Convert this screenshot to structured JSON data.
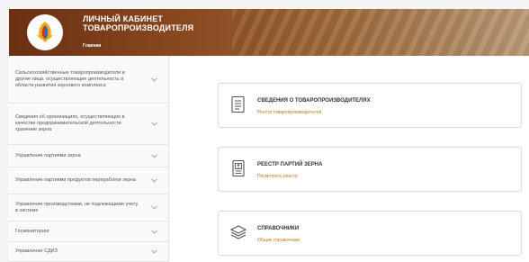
{
  "header": {
    "title_line1": "ЛИЧНЫЙ КАБИНЕТ",
    "title_line2": "ТОВАРОПРОИЗВОДИТЕЛЯ",
    "nav_home": "Главная"
  },
  "sidebar": {
    "items": [
      {
        "label": "Сельскохозяйственные товаропроизводители и другие лица, осуществляющие деятельность в области развития зернового комплекса"
      },
      {
        "label": "Сведения об организациях, осуществляющих в качестве предпринимательской деятельности хранение зерна"
      },
      {
        "label": "Управление партиями зерна"
      },
      {
        "label": "Управление партиями продуктов переработки зерна"
      },
      {
        "label": "Управление производствами, не подлежащими учету в системе"
      },
      {
        "label": "Госмониторинг"
      },
      {
        "label": "Управление СДИЗ"
      }
    ]
  },
  "cards": [
    {
      "title": "СВЕДЕНИЯ О ТОВАРОПРОИЗВОДИТЕЛЯХ",
      "link": "Реестр товаропроизводителей",
      "icon": "document-list-icon"
    },
    {
      "title": "РЕЕСТР ПАРТИЙ ЗЕРНА",
      "link": "Посмотреть реестр",
      "icon": "grain-register-icon"
    },
    {
      "title": "СПРАВОЧНИКИ",
      "link": "Общие справочники",
      "icon": "layers-icon"
    }
  ],
  "colors": {
    "header_brown": "#6b2f12",
    "link_orange": "#c07a1c",
    "sidebar_bg": "#fafafa"
  }
}
